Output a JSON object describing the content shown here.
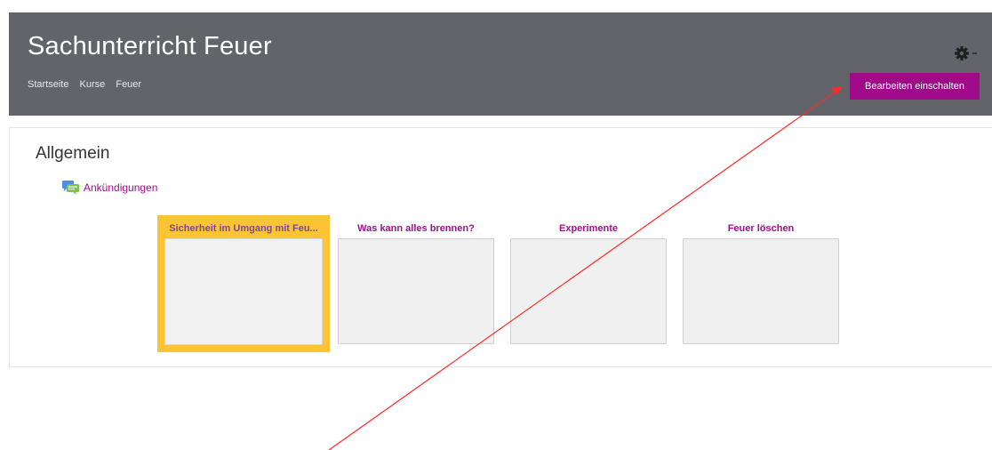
{
  "header": {
    "title": "Sachunterricht Feuer",
    "breadcrumb": [
      "Startseite",
      "Kurse",
      "Feuer"
    ],
    "edit_button_label": "Bearbeiten einschalten",
    "settings_icon": "gear-icon",
    "background_color": "#636469",
    "accent_color": "#9e0a8a"
  },
  "section": {
    "title": "Allgemein",
    "forum_link": {
      "label": "Ankündigungen",
      "icon": "forum-icon"
    }
  },
  "tiles": [
    {
      "title": "Sicherheit im Umgang mit Feu...",
      "active": true
    },
    {
      "title": "Was kann alles brennen?",
      "active": false
    },
    {
      "title": "Experimente",
      "active": false
    },
    {
      "title": "Feuer löschen",
      "active": false
    }
  ],
  "annotation": {
    "type": "red-arrow",
    "color": "#ff0000",
    "points_to": "edit-button"
  }
}
